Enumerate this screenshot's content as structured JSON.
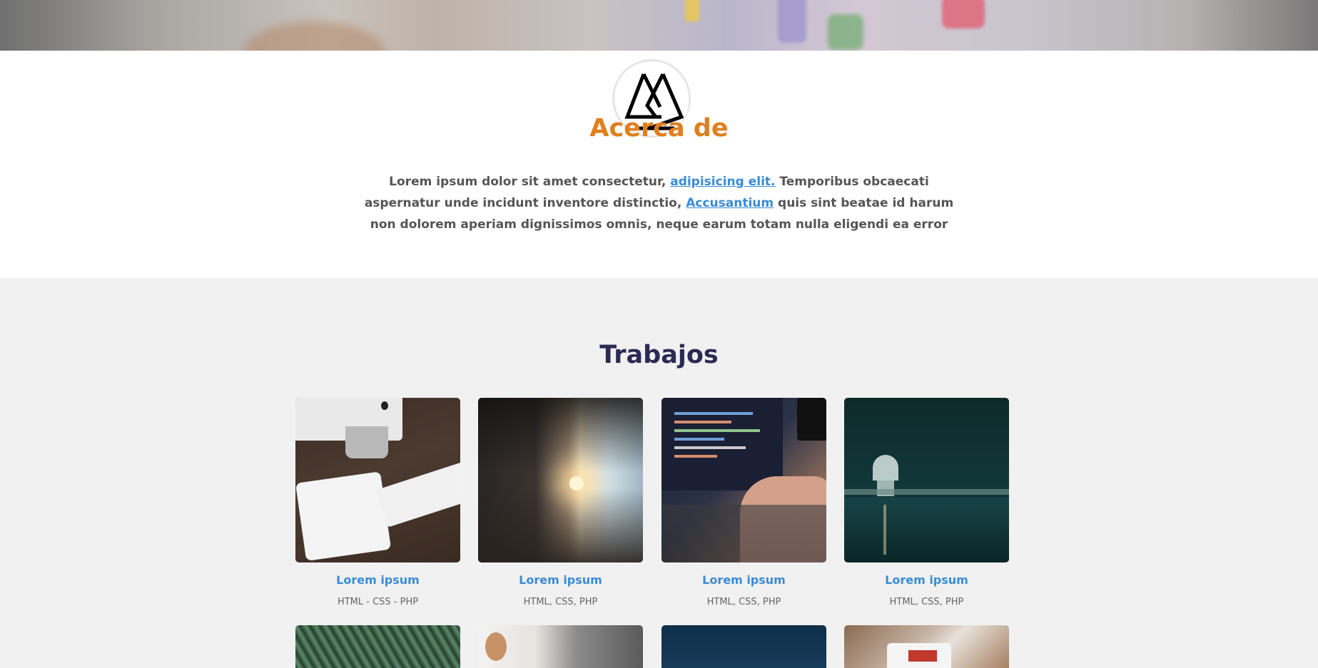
{
  "about": {
    "title": "Acerca de",
    "text_1": "Lorem ipsum dolor sit amet consectetur, ",
    "link_1": "adipisicing elit.",
    "text_2": " Temporibus obcaecati aspernatur unde incidunt inventore distinctio, ",
    "link_2": "Accusantium",
    "text_3": " quis sint beatae id harum non dolorem aperiam dignissimos omnis, neque earum totam nulla eligendi ea error"
  },
  "works": {
    "title": "Trabajos",
    "items": [
      {
        "title": "Lorem ipsum",
        "tags": "HTML - CSS - PHP"
      },
      {
        "title": "Lorem ipsum",
        "tags": "HTML, CSS, PHP"
      },
      {
        "title": "Lorem ipsum",
        "tags": "HTML, CSS, PHP"
      },
      {
        "title": "Lorem ipsum",
        "tags": "HTML, CSS, PHP"
      }
    ]
  },
  "colors": {
    "accent": "#e07f1e",
    "link": "#3a8bd6",
    "works_title": "#2d2b54",
    "works_bg": "#f1f1f1"
  }
}
